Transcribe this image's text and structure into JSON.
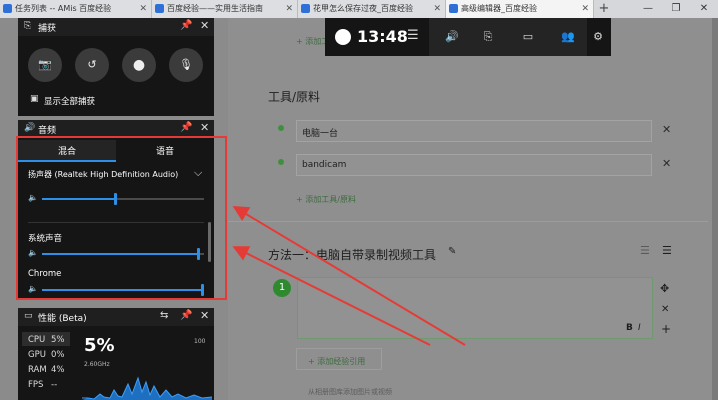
{
  "browser": {
    "tabs": [
      {
        "title": "任务列表 -- AMis 百度经验",
        "active": false
      },
      {
        "title": "百度经验——实用生活指南",
        "active": false
      },
      {
        "title": "花甲怎么保存过夜_百度经验",
        "active": false
      },
      {
        "title": "高级编辑器_百度经验",
        "active": true
      }
    ],
    "new_tab": "+",
    "window_controls": {
      "minimize": "—",
      "restore": "❐",
      "close": "✕"
    }
  },
  "editor": {
    "top_link": "+ 添加工具",
    "section_tools_title": "工具/原料",
    "tools": [
      "电脑一台",
      "bandicam"
    ],
    "add_tool_link": "+ 添加工具/原料",
    "method_title": "方法一：电脑自带录制视频工具",
    "step_number": "1",
    "format_bold": "B",
    "format_italic": "I",
    "add_citation_link": "+ 添加经验引用",
    "footer_hint": "从相册图库添加图片或视频"
  },
  "gamebar": {
    "time": "13:48",
    "accent_color": "#2e8fe6"
  },
  "capture_widget": {
    "title": "捕获",
    "show_all_captures": "显示全部捕获"
  },
  "audio_widget": {
    "title": "音频",
    "tabs": [
      "混合",
      "语音"
    ],
    "active_tab": "混合",
    "device_label": "扬声器 (Realtek High Definition Audio)",
    "device_volume": 0.45,
    "apps": [
      {
        "name": "系统声音",
        "volume": 0.96
      },
      {
        "name": "Chrome",
        "volume": 1.0
      }
    ]
  },
  "performance_widget": {
    "title": "性能 (Beta)",
    "stats": [
      {
        "key": "CPU",
        "value": "5%"
      },
      {
        "key": "GPU",
        "value": "0%"
      },
      {
        "key": "RAM",
        "value": "4%"
      },
      {
        "key": "FPS",
        "value": "--"
      }
    ],
    "big_value": "5%",
    "frequency": "2.60GHz",
    "scale_max": "100"
  },
  "annotation_color": "#e53b36"
}
